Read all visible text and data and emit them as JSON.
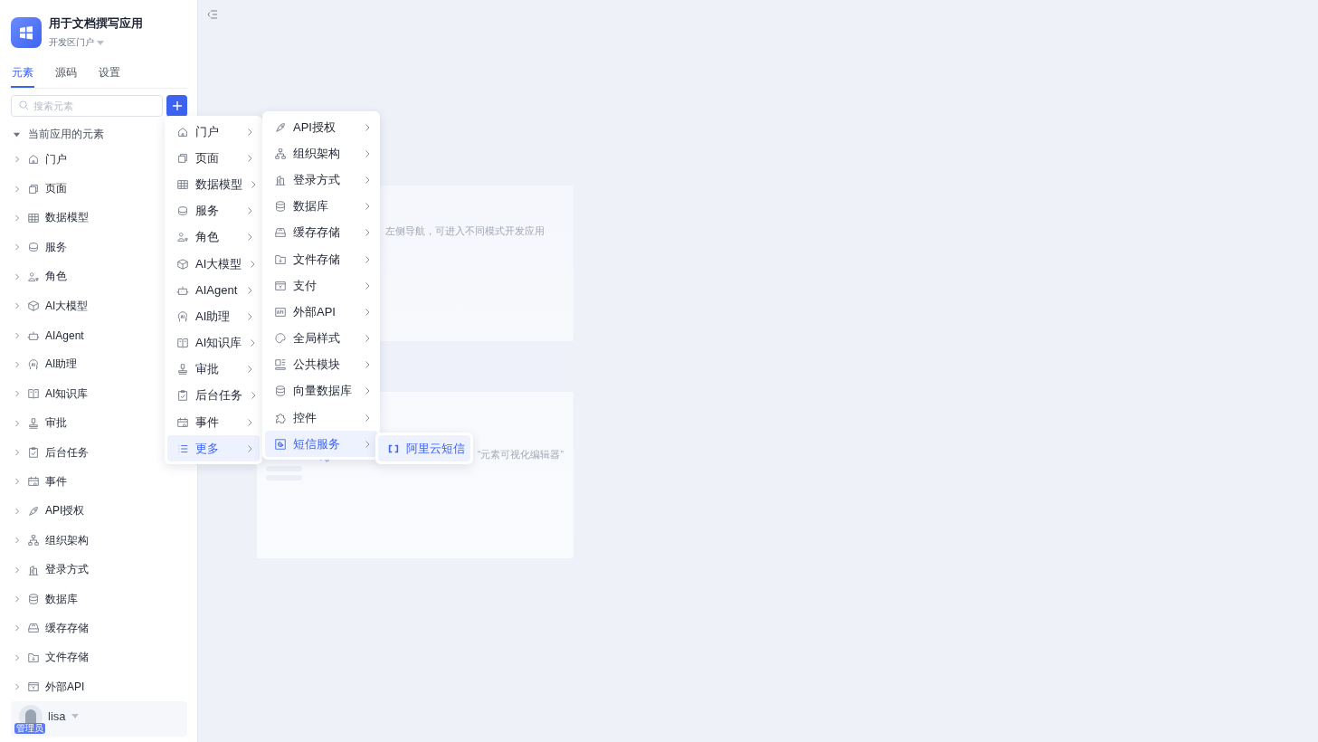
{
  "app": {
    "title": "用于文档撰写应用",
    "portal": "开发区门户"
  },
  "tabs": [
    {
      "label": "元素",
      "selected": true
    },
    {
      "label": "源码",
      "selected": false
    },
    {
      "label": "设置",
      "selected": false
    }
  ],
  "search": {
    "placeholder": "搜索元素"
  },
  "tree": {
    "label": "当前应用的元素",
    "expanded": true,
    "children": [
      {
        "label": "门户",
        "expanded": false
      },
      {
        "label": "页面",
        "expanded": false
      },
      {
        "label": "数据模型",
        "expanded": false
      },
      {
        "label": "服务",
        "expanded": false
      },
      {
        "label": "角色",
        "expanded": false
      },
      {
        "label": "AI大模型",
        "expanded": false
      },
      {
        "label": "AIAgent",
        "expanded": false
      },
      {
        "label": "AI助理",
        "expanded": false
      },
      {
        "label": "AI知识库",
        "expanded": false
      },
      {
        "label": "审批",
        "expanded": false
      },
      {
        "label": "后台任务",
        "expanded": false
      },
      {
        "label": "事件",
        "expanded": false
      },
      {
        "label": "API授权",
        "expanded": false
      },
      {
        "label": "组织架构",
        "expanded": false
      },
      {
        "label": "登录方式",
        "expanded": false
      },
      {
        "label": "数据库",
        "expanded": false
      },
      {
        "label": "缓存存储",
        "expanded": false
      },
      {
        "label": "文件存储",
        "expanded": false
      },
      {
        "label": "外部API",
        "expanded": false
      }
    ]
  },
  "user": {
    "name": "lisa",
    "role": "管理员"
  },
  "menu": [
    {
      "label": "门户",
      "selected": false
    },
    {
      "label": "页面",
      "selected": false
    },
    {
      "label": "数据模型",
      "selected": false
    },
    {
      "label": "服务",
      "selected": false
    },
    {
      "label": "角色",
      "selected": false
    },
    {
      "label": "AI大模型",
      "selected": false
    },
    {
      "label": "AIAgent",
      "selected": false
    },
    {
      "label": "AI助理",
      "selected": false
    },
    {
      "label": "AI知识库",
      "selected": false
    },
    {
      "label": "审批",
      "selected": false
    },
    {
      "label": "后台任务",
      "selected": false
    },
    {
      "label": "事件",
      "selected": false
    },
    {
      "label": "更多",
      "selected": true
    }
  ],
  "submenu": [
    {
      "label": "API授权",
      "selected": false
    },
    {
      "label": "组织架构",
      "selected": false
    },
    {
      "label": "登录方式",
      "selected": false
    },
    {
      "label": "数据库",
      "selected": false
    },
    {
      "label": "缓存存储",
      "selected": false
    },
    {
      "label": "文件存储",
      "selected": false
    },
    {
      "label": "支付",
      "selected": false
    },
    {
      "label": "外部API",
      "selected": false
    },
    {
      "label": "全局样式",
      "selected": false
    },
    {
      "label": "公共模块",
      "selected": false
    },
    {
      "label": "向量数据库",
      "selected": false
    },
    {
      "label": "控件",
      "selected": false
    },
    {
      "label": "短信服务",
      "selected": true
    }
  ],
  "submenu_2": [
    {
      "label": "阿里云短信",
      "selected": true
    }
  ],
  "hint_card": {
    "line_1": "左侧导航，可进入不同模式开发应用",
    "line_2": "“元素可视化编辑器”"
  }
}
